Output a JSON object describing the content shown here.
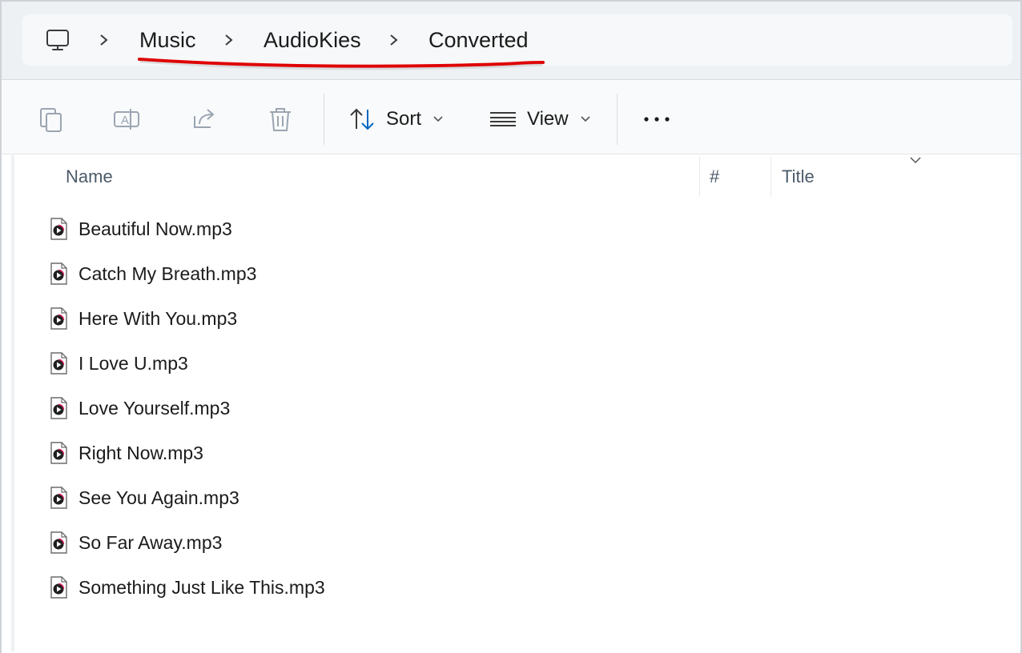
{
  "breadcrumb": {
    "root_icon": "computer-icon",
    "items": [
      "Music",
      "AudioKies",
      "Converted"
    ],
    "annotation_color": "#e00000"
  },
  "toolbar": {
    "copy_icon": "copy-icon",
    "rename_icon": "rename-icon",
    "share_icon": "share-icon",
    "delete_icon": "delete-icon",
    "sort_label": "Sort",
    "view_label": "View",
    "more_icon": "more-icon"
  },
  "columns": {
    "name": "Name",
    "number": "#",
    "title": "Title"
  },
  "files": [
    "Beautiful Now.mp3",
    "Catch My Breath.mp3",
    "Here With You.mp3",
    "I Love U.mp3",
    "Love Yourself.mp3",
    "Right Now.mp3",
    "See You Again.mp3",
    "So Far Away.mp3",
    "Something Just Like This.mp3"
  ],
  "colors": {
    "accent": "#0067c0",
    "disabled_icon": "#9aa5b1"
  }
}
